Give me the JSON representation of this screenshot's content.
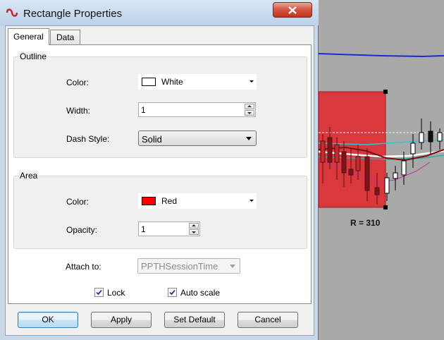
{
  "window": {
    "title": "Rectangle Properties"
  },
  "tabs": [
    {
      "label": "General",
      "active": true
    },
    {
      "label": "Data",
      "active": false
    }
  ],
  "outline": {
    "group_title": "Outline",
    "color_label": "Color:",
    "color_value": "White",
    "color_hex": "#ffffff",
    "width_label": "Width:",
    "width_value": "1",
    "dash_label": "Dash Style:",
    "dash_value": "Solid"
  },
  "area": {
    "group_title": "Area",
    "color_label": "Color:",
    "color_value": "Red",
    "color_hex": "#ff0000",
    "opacity_label": "Opacity:",
    "opacity_value": "1"
  },
  "attach": {
    "label": "Attach to:",
    "value": "PPTHSessionTime"
  },
  "checkboxes": {
    "lock": {
      "label": "Lock",
      "checked": true
    },
    "autoscale": {
      "label": "Auto scale",
      "checked": true
    }
  },
  "buttons": {
    "ok": "OK",
    "apply": "Apply",
    "set_default": "Set Default",
    "cancel": "Cancel"
  },
  "chart": {
    "rectangle_label": "R = 310",
    "rectangle_color": "#d9383c",
    "line_color": "#1a2bd6"
  }
}
